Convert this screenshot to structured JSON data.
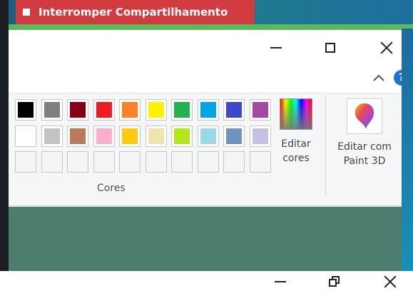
{
  "share_bar": {
    "label": "Interromper Compartilhamento"
  },
  "window": {
    "buttons": {
      "minimize": "minimize",
      "maximize": "maximize",
      "close": "close"
    }
  },
  "ribbon": {
    "palette": {
      "row1": [
        "#000000",
        "#7f7f7f",
        "#880015",
        "#ed1c24",
        "#ff7f27",
        "#fff200",
        "#22b14c",
        "#00a2e8",
        "#3f48cc",
        "#a349a4"
      ],
      "row2": [
        "#ffffff",
        "#c3c3c3",
        "#b97a57",
        "#ffaec9",
        "#ffc90e",
        "#efe4b0",
        "#b5e61d",
        "#99d9ea",
        "#7092be",
        "#c8bfe7"
      ],
      "row3_empty": 10
    },
    "group_label": "Cores",
    "edit_colors": {
      "line1": "Editar",
      "line2": "cores"
    },
    "edit_paint3d": {
      "line1": "Editar com",
      "line2": "Paint 3D"
    },
    "help": "?"
  }
}
